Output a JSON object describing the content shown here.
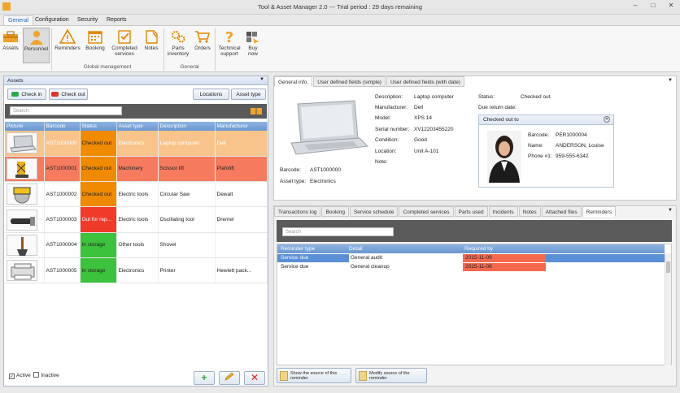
{
  "window": {
    "title": "Tool & Asset Manager 2.0 --- Trial period : 29 days remaining"
  },
  "ribbon_tabs": [
    "General",
    "Configuration",
    "Security",
    "Reports"
  ],
  "ribbon": {
    "assets": "Assets",
    "personnel": "Personnel",
    "reminders": "Reminders",
    "booking": "Booking",
    "completed_services_1": "Completed",
    "completed_services_2": "services",
    "notes": "Notes",
    "parts_inventory_1": "Parts",
    "parts_inventory_2": "inventory",
    "orders": "Orders",
    "technical_support_1": "Technical",
    "technical_support_2": "support",
    "buy_now_1": "Buy",
    "buy_now_2": "now",
    "group_global": "Global management",
    "group_general": "General"
  },
  "assets_panel": {
    "title": "Assets",
    "check_in": "Check in",
    "check_out": "Check out",
    "locations": "Locations",
    "asset_type": "Asset type",
    "search_placeholder": "Search",
    "columns": [
      "Picture",
      "Barcode",
      "Status",
      "Asset type",
      "Description",
      "Manufacturer"
    ],
    "rows": [
      {
        "barcode": "AST1000000",
        "status": "Checked out",
        "asset_type": "Electronics",
        "description": "Laptop computer",
        "manufacturer": "Dell",
        "status_color": "#f08a00"
      },
      {
        "barcode": "AST1000001",
        "status": "Checked out",
        "asset_type": "Machinery",
        "description": "Scissor lift",
        "manufacturer": "Plafolift",
        "status_color": "#f08a00"
      },
      {
        "barcode": "AST1000002",
        "status": "Checked out",
        "asset_type": "Electric tools",
        "description": "Circular Saw",
        "manufacturer": "Dewalt",
        "status_color": "#f08a00"
      },
      {
        "barcode": "AST1000003",
        "status": "Out for rep...",
        "asset_type": "Electric tools",
        "description": "Oscillating tool",
        "manufacturer": "Dremel",
        "status_color": "#f03a2a"
      },
      {
        "barcode": "AST1000004",
        "status": "In storage",
        "asset_type": "Other tools",
        "description": "Shovel",
        "manufacturer": "",
        "status_color": "#3cc23c"
      },
      {
        "barcode": "AST1000005",
        "status": "In storage",
        "asset_type": "Electronics",
        "description": "Printer",
        "manufacturer": "Hewlett pack...",
        "status_color": "#3cc23c"
      }
    ],
    "active_label": "Active",
    "inactive_label": "Inactive"
  },
  "info_tabs": [
    "General info.",
    "User defined fields (simple)",
    "User defined fields (with date)"
  ],
  "info": {
    "description_label": "Description:",
    "description": "Laptop computer",
    "manufacturer_label": "Manufacturer:",
    "manufacturer": "Dell",
    "model_label": "Model:",
    "model": "XPS 14",
    "serial_label": "Serial number:",
    "serial": "XV12203455220",
    "condition_label": "Condition:",
    "condition": "Good",
    "location_label": "Location:",
    "location": "Unit A-101",
    "note_label": "Note:",
    "status_label": "Status:",
    "status": "Checked out",
    "due_label": "Due return date:",
    "barcode_label": "Barcode:",
    "barcode": "AST1000000",
    "asset_type_label": "Asset type:",
    "asset_type": "Electronics"
  },
  "checked_out_to": {
    "title": "Checked out to",
    "barcode_label": "Barcode:",
    "barcode": "PER1000004",
    "name_label": "Name:",
    "name": "ANDERSON, Louise",
    "phone_label": "Phone #1:",
    "phone": "959-555-6342"
  },
  "bottom_tabs": [
    "Transactions log",
    "Booking",
    "Service schedule",
    "Completed services",
    "Parts used",
    "Incidents",
    "Notes",
    "Attached files",
    "Reminders"
  ],
  "reminders": {
    "search_placeholder": "Search",
    "columns": [
      "Reminder type",
      "Detail",
      "Required by"
    ],
    "rows": [
      {
        "type": "Service due",
        "detail": "General audit",
        "required_by": "2015-11-09"
      },
      {
        "type": "Service due",
        "detail": "General cleanup",
        "required_by": "2015-11-08"
      }
    ],
    "show_source_1": "Show the source of this",
    "show_source_2": "reminder",
    "modify_source_1": "Modify source of the",
    "modify_source_2": "reminder"
  },
  "colors": {
    "accent": "#1f5fb0",
    "header_blue": "#6b97d0",
    "overdue": "#f5694f"
  }
}
